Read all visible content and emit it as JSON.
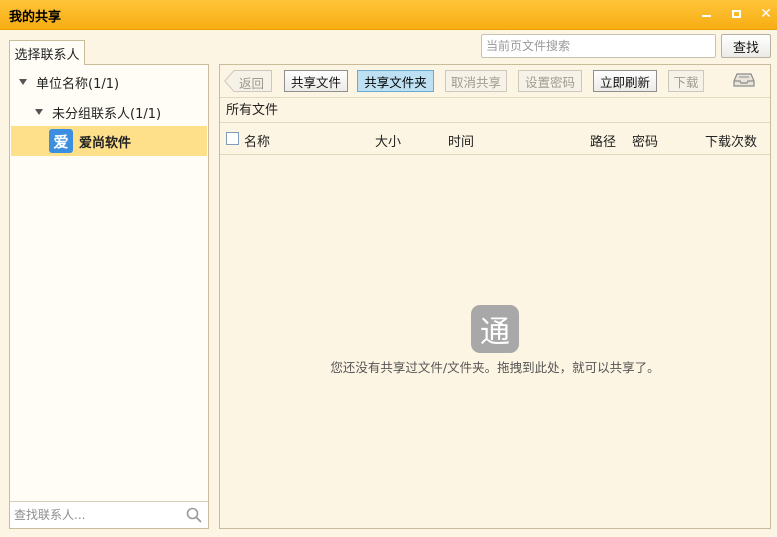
{
  "window": {
    "title": "我的共享",
    "minimize_icon": "minimize-icon",
    "maximize_icon": "maximize-icon",
    "close_icon": "close-icon"
  },
  "left": {
    "tab_label": "选择联系人",
    "tree": {
      "group1_label": "单位名称(1/1)",
      "group2_label": "未分组联系人(1/1)",
      "contact": {
        "avatar_char": "爱",
        "name": "爱尚软件",
        "avatar_color": "#3c8fe0"
      }
    },
    "contact_search_placeholder": "查找联系人..."
  },
  "top_search": {
    "placeholder": "当前页文件搜索",
    "button_label": "查找"
  },
  "toolbar": {
    "back_label": "返回",
    "share_file_label": "共享文件",
    "share_folder_label": "共享文件夹",
    "cancel_share_label": "取消共享",
    "set_password_label": "设置密码",
    "refresh_label": "立即刷新",
    "download_label": "下载"
  },
  "files": {
    "section_label": "所有文件",
    "columns": {
      "name": "名称",
      "size": "大小",
      "time": "时间",
      "path": "路径",
      "password": "密码",
      "downloads": "下载次数"
    },
    "empty_icon_char": "通",
    "empty_message": "您还没有共享过文件/文件夹。拖拽到此处，就可以共享了。"
  },
  "colors": {
    "title_bar": "#f7ad12",
    "background": "#fdf5e3",
    "selected_row": "#fee08a",
    "active_button": "#bde0f3"
  }
}
